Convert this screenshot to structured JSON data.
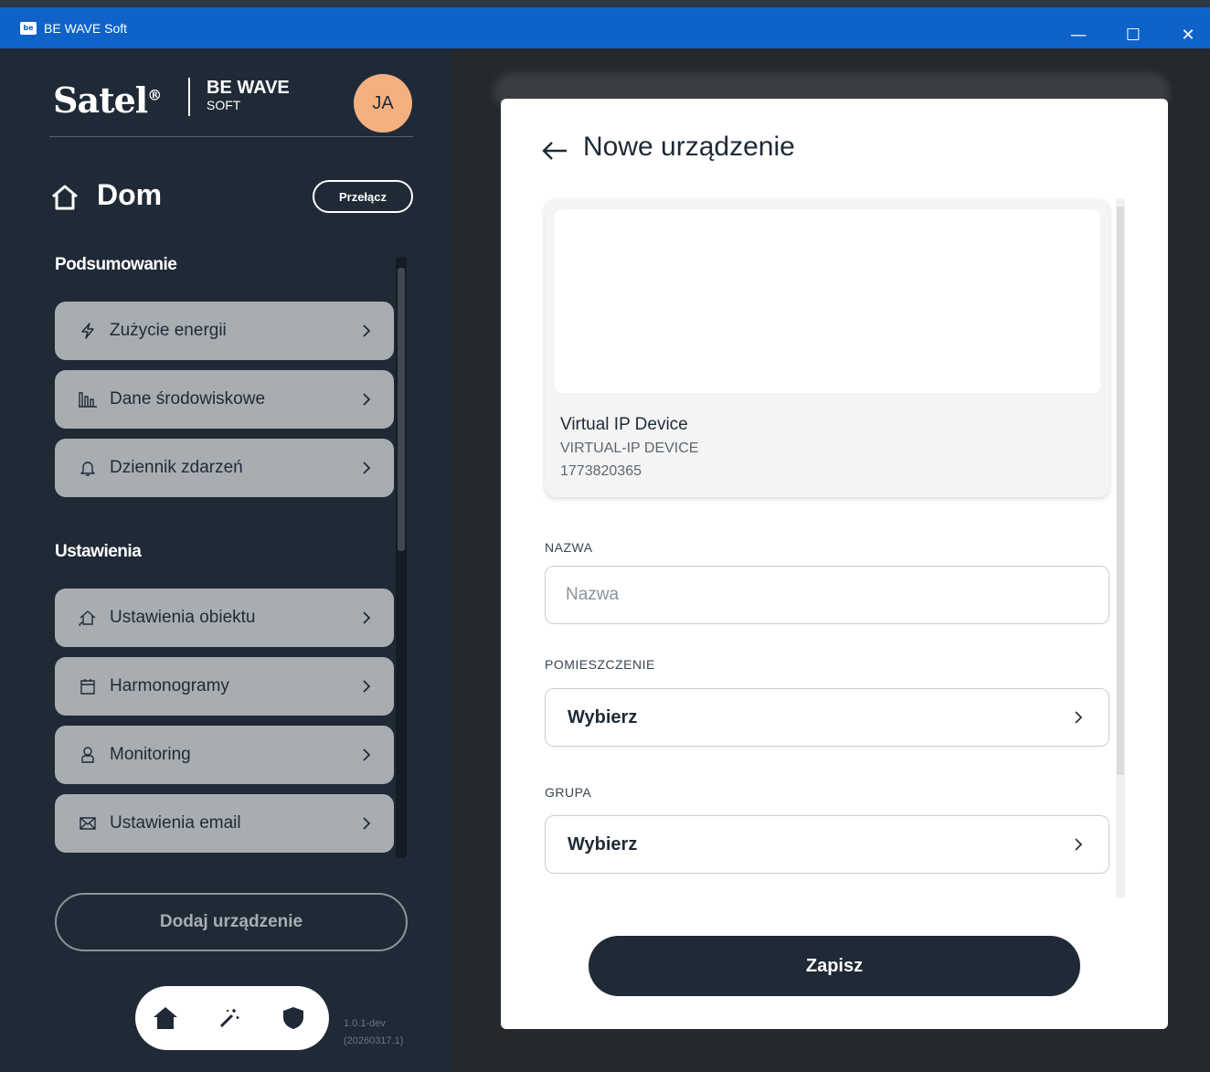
{
  "window": {
    "title": "BE WAVE Soft",
    "app_icon": "be",
    "minimize_glyph": "—",
    "maximize_glyph": "☐",
    "close_glyph": "✕"
  },
  "sidebar": {
    "logo": {
      "brand": "Satel",
      "brand_mark": "®",
      "product": "BE WAVE",
      "product_sub": "SOFT"
    },
    "avatar_initials": "JA",
    "home": {
      "title": "Dom",
      "switch_label": "Przełącz"
    },
    "sections": [
      {
        "label": "Podsumowanie",
        "items": [
          {
            "label": "Zużycie energii",
            "icon": "lightning-icon"
          },
          {
            "label": "Dane środowiskowe",
            "icon": "bar-chart-icon"
          },
          {
            "label": "Dziennik zdarzeń",
            "icon": "bell-icon"
          }
        ]
      },
      {
        "label": "Ustawienia",
        "items": [
          {
            "label": "Ustawienia obiektu",
            "icon": "house-settings-icon"
          },
          {
            "label": "Harmonogramy",
            "icon": "calendar-icon"
          },
          {
            "label": "Monitoring",
            "icon": "person-icon"
          },
          {
            "label": "Ustawienia email",
            "icon": "envelope-icon"
          }
        ]
      }
    ],
    "add_device_label": "Dodaj urządzenie",
    "bottom_nav": [
      "home-icon",
      "magic-wand-icon",
      "shield-icon"
    ],
    "version_line1": "1.0.1-dev",
    "version_line2": "(20260317.1)"
  },
  "modal": {
    "title": "Nowe urządzenie",
    "device": {
      "name": "Virtual IP Device",
      "model": "VIRTUAL-IP DEVICE",
      "serial": "1773820365"
    },
    "fields": {
      "name_label": "NAZWA",
      "name_placeholder": "Nazwa",
      "name_value": "",
      "room_label": "POMIESZCZENIE",
      "room_value": "Wybierz",
      "group_label": "GRUPA",
      "group_value": "Wybierz"
    },
    "save_label": "Zapisz"
  },
  "colors": {
    "titlebar": "#0e62c8",
    "sidebar": "#1f2a36",
    "menu_item": "#a8adb2",
    "avatar": "#f5b080",
    "primary_button": "#1f2a36"
  }
}
